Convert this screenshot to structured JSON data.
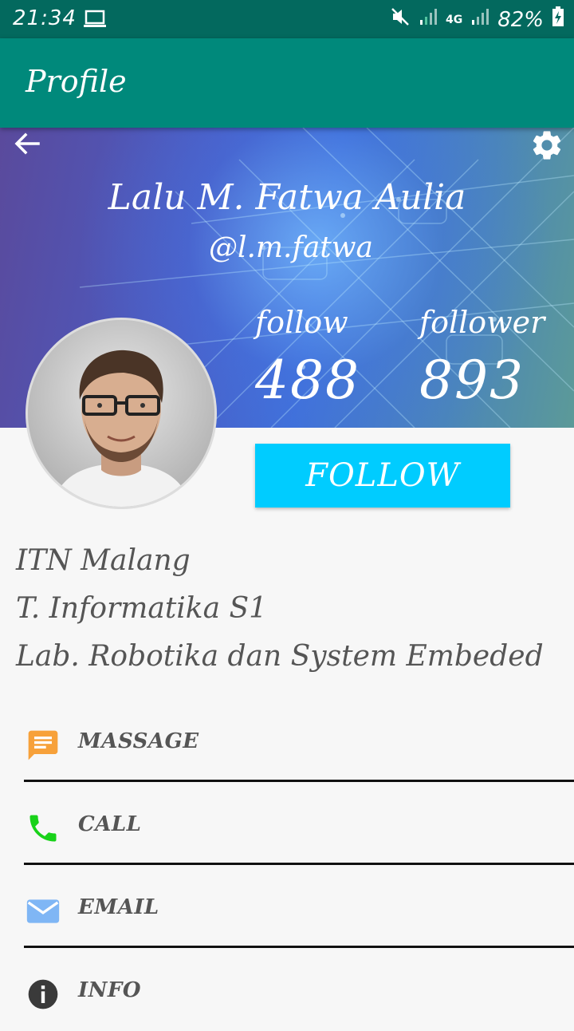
{
  "status_bar": {
    "time": "21:34",
    "network": "4G",
    "battery": "82%"
  },
  "app_bar": {
    "title": "Profile"
  },
  "profile": {
    "name": "Lalu M. Fatwa Aulia",
    "handle": "@l.m.fatwa",
    "follow_label": "follow",
    "follow_count": "488",
    "follower_label": "follower",
    "follower_count": "893",
    "follow_button": "FOLLOW"
  },
  "details": [
    "ITN Malang",
    "T. Informatika S1",
    "Lab. Robotika dan System Embeded"
  ],
  "actions": [
    {
      "label": "MASSAGE",
      "icon": "message-icon",
      "color": "#f7a13a"
    },
    {
      "label": "CALL",
      "icon": "phone-icon",
      "color": "#19d21a"
    },
    {
      "label": "EMAIL",
      "icon": "email-icon",
      "color": "#7fb6f5"
    },
    {
      "label": "INFO",
      "icon": "info-icon",
      "color": "#3a3a3a"
    }
  ],
  "colors": {
    "status_bar": "#03695e",
    "app_bar": "#00897b",
    "follow_button": "#00ccff"
  }
}
